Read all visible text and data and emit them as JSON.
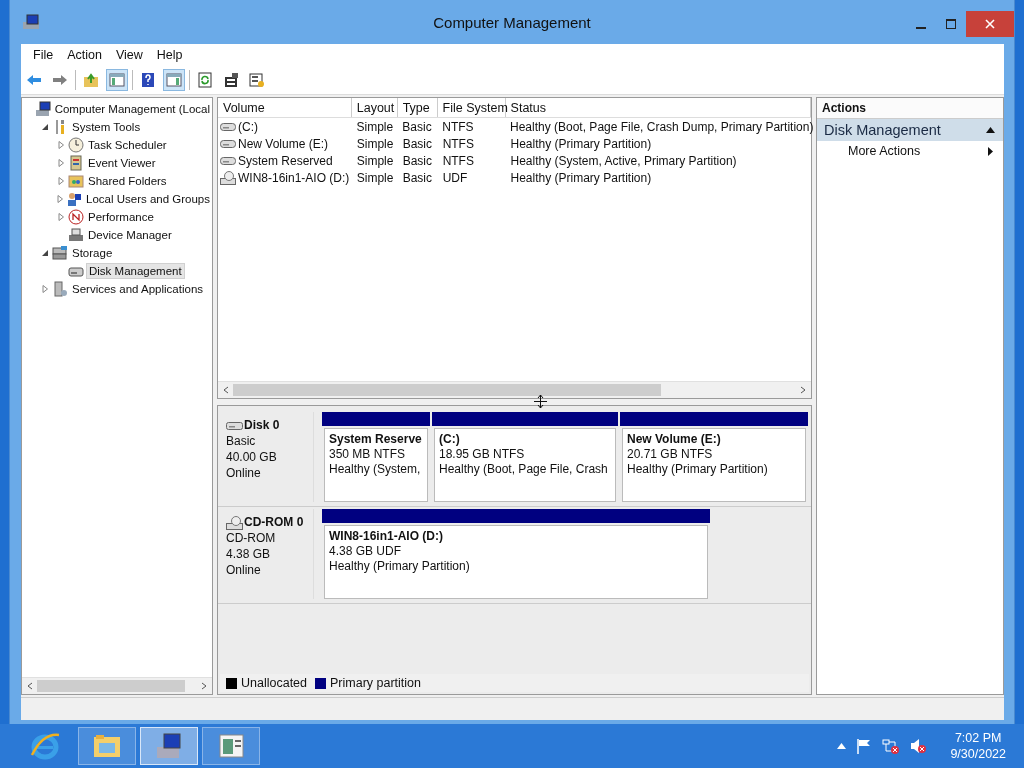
{
  "window": {
    "title": "Computer Management"
  },
  "menu": [
    "File",
    "Action",
    "View",
    "Help"
  ],
  "toolbar": [
    {
      "kind": "back",
      "pressed": false
    },
    {
      "kind": "forward",
      "pressed": false
    },
    {
      "kind": "sep"
    },
    {
      "kind": "folder-up",
      "pressed": false
    },
    {
      "kind": "tree-pane",
      "pressed": true
    },
    {
      "kind": "sep"
    },
    {
      "kind": "help",
      "pressed": false
    },
    {
      "kind": "action-pane",
      "pressed": true
    },
    {
      "kind": "sep"
    },
    {
      "kind": "refresh",
      "pressed": false
    },
    {
      "kind": "properties",
      "pressed": false
    },
    {
      "kind": "settings",
      "pressed": false
    }
  ],
  "tree": [
    {
      "label": "Computer Management (Local",
      "kind": "computer",
      "selected": false,
      "children": [
        {
          "label": "System Tools",
          "kind": "tools",
          "expanded": true,
          "selected": false,
          "children": [
            {
              "label": "Task Scheduler",
              "kind": "clock",
              "expanded": false,
              "selected": false
            },
            {
              "label": "Event Viewer",
              "kind": "log",
              "expanded": false,
              "selected": false
            },
            {
              "label": "Shared Folders",
              "kind": "folder",
              "expanded": false,
              "selected": false
            },
            {
              "label": "Local Users and Groups",
              "kind": "users",
              "expanded": false,
              "selected": false
            },
            {
              "label": "Performance",
              "kind": "gauge",
              "expanded": false,
              "selected": false
            },
            {
              "label": "Device Manager",
              "kind": "printer",
              "selected": false
            }
          ]
        },
        {
          "label": "Storage",
          "kind": "storage",
          "expanded": true,
          "selected": false,
          "children": [
            {
              "label": "Disk Management",
              "kind": "disk",
              "selected": true
            }
          ]
        },
        {
          "label": "Services and Applications",
          "kind": "server",
          "expanded": false,
          "selected": false
        }
      ]
    }
  ],
  "volumes": {
    "columns": [
      "Volume",
      "Layout",
      "Type",
      "File System",
      "Status"
    ],
    "rows": [
      {
        "kind": "disk",
        "cells": [
          " (C:)",
          "Simple",
          "Basic",
          "NTFS",
          "Healthy (Boot, Page File, Crash Dump, Primary Partition)"
        ]
      },
      {
        "kind": "disk",
        "cells": [
          "New Volume (E:)",
          "Simple",
          "Basic",
          "NTFS",
          "Healthy (Primary Partition)"
        ]
      },
      {
        "kind": "disk",
        "cells": [
          "System Reserved",
          "Simple",
          "Basic",
          "NTFS",
          "Healthy (System, Active, Primary Partition)"
        ]
      },
      {
        "kind": "cdrom",
        "cells": [
          "WIN8-16in1-AIO (D:)",
          "Simple",
          "Basic",
          "UDF",
          "Healthy (Primary Partition)"
        ]
      }
    ]
  },
  "disks": [
    {
      "kind": "disk",
      "name": "Disk 0",
      "type": "Basic",
      "size": "40.00 GB",
      "state": "Online",
      "partitions": [
        {
          "name": "System Reserve",
          "size": "350 MB NTFS",
          "status": "Healthy (System,",
          "color": "#000080"
        },
        {
          "name": " (C:)",
          "size": "18.95 GB NTFS",
          "status": "Healthy (Boot, Page File, Crash",
          "color": "#000080"
        },
        {
          "name": "New Volume  (E:)",
          "size": "20.71 GB NTFS",
          "status": "Healthy (Primary Partition)",
          "color": "#000080"
        }
      ]
    },
    {
      "kind": "cdrom",
      "name": "CD-ROM 0",
      "type": "CD-ROM",
      "size": "4.38 GB",
      "state": "Online",
      "partitions": [
        {
          "name": "WIN8-16in1-AIO  (D:)",
          "size": "4.38 GB UDF",
          "status": "Healthy (Primary Partition)",
          "color": "#000080"
        }
      ]
    }
  ],
  "legend": [
    {
      "label": "Unallocated",
      "color": "#000000"
    },
    {
      "label": "Primary partition",
      "color": "#000080"
    }
  ],
  "actions": {
    "title": "Actions",
    "sections": [
      {
        "label": "Disk Management",
        "expanded": true,
        "items": [
          {
            "label": "More Actions"
          }
        ]
      }
    ]
  },
  "taskbar": {
    "apps": [
      {
        "kind": "browser",
        "selected": false
      },
      {
        "kind": "explorer",
        "selected": false
      },
      {
        "kind": "management",
        "selected": true
      },
      {
        "kind": "document",
        "selected": false
      }
    ],
    "time": "7:02 PM",
    "date": "9/30/2022"
  }
}
